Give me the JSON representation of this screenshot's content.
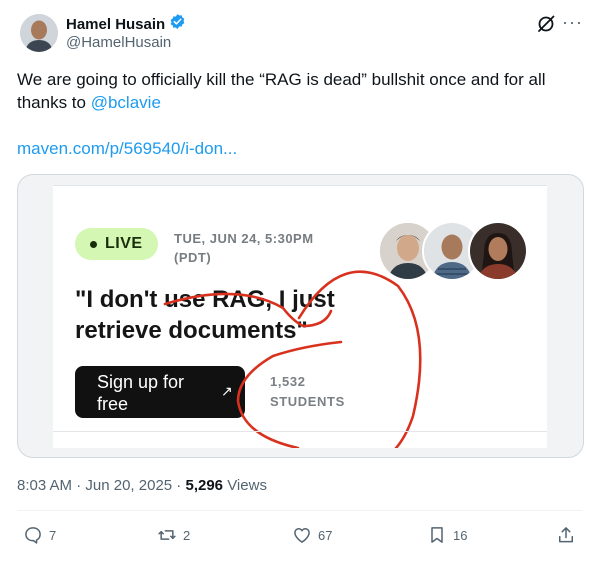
{
  "author": {
    "name": "Hamel Husain",
    "handle": "@HamelHusain",
    "verified": true
  },
  "tweet": {
    "text_before": "We are going to officially kill the “RAG is dead” bullshit once and for all thanks to ",
    "mention": "@bclavie",
    "link": "maven.com/p/569540/i-don..."
  },
  "card": {
    "live_label": "LIVE",
    "date_line1": "TUE, JUN 24, 5:30PM",
    "date_line2": "(PDT)",
    "headline": "\"I don't use RAG, I just retrieve documents\"",
    "signup_label": "Sign up for free",
    "student_count": "1,532",
    "students_label": "STUDENTS"
  },
  "meta": {
    "time": "8:03 AM",
    "separator": " · ",
    "date": "Jun 20, 2025",
    "views_count": "5,296",
    "views_label": " Views"
  },
  "actions": {
    "replies": "7",
    "reposts": "2",
    "likes": "67",
    "bookmarks": "16"
  },
  "colors": {
    "accent": "#1d9bf0",
    "live_badge": "#d5f7b4",
    "annotation_red": "#d8321f"
  },
  "icons": [
    "verified-badge-icon",
    "grok-icon",
    "more-icon",
    "reply-icon",
    "repost-icon",
    "like-icon",
    "bookmark-icon",
    "share-icon",
    "arrow-icon"
  ]
}
